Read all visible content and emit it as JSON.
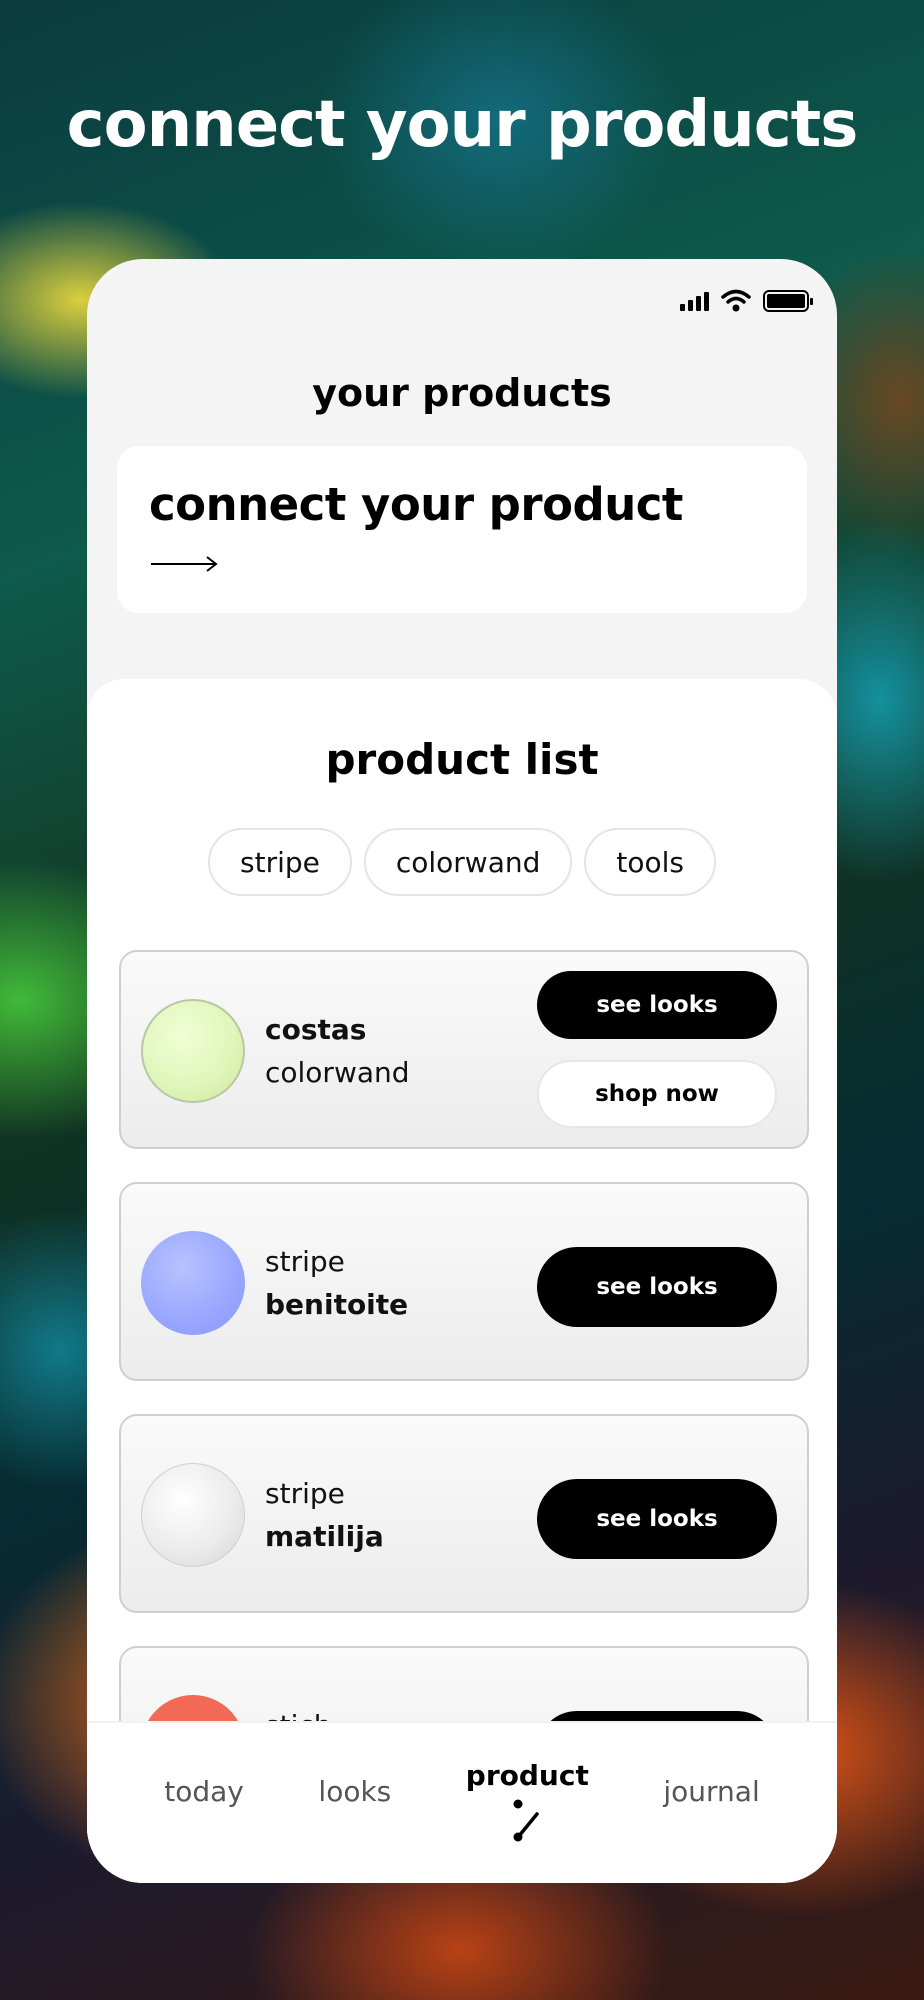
{
  "hero": {
    "title": "connect your products"
  },
  "screen": {
    "title": "your products",
    "connect_card": {
      "title": "connect your product",
      "arrow_icon": "long-arrow-right-icon"
    },
    "product_list": {
      "title": "product list",
      "filters": [
        "stripe",
        "colorwand",
        "tools"
      ],
      "items": [
        {
          "line1": "costas",
          "line2": "colorwand",
          "swatch_color": "#dff5b8",
          "primary_button": "see looks",
          "secondary_button": "shop now"
        },
        {
          "line1": "stripe",
          "line2": "benitoite",
          "swatch_color": "#98a6ff",
          "primary_button": "see looks"
        },
        {
          "line1": "stripe",
          "line2": "matilija",
          "swatch_color": "#eaeaea",
          "primary_button": "see looks"
        },
        {
          "line1": "stich",
          "swatch_color": "#f26a55"
        }
      ]
    },
    "tab_bar": {
      "tabs": [
        "today",
        "looks",
        "product",
        "journal"
      ],
      "active_tab": "product",
      "active_icon": "wand-icon"
    }
  },
  "status_bar": {
    "icons": [
      "signal-icon",
      "wifi-icon",
      "battery-icon"
    ]
  }
}
